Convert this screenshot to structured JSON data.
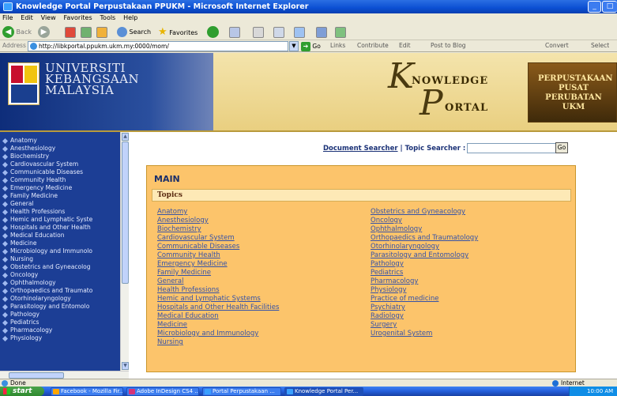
{
  "window": {
    "title": "Knowledge Portal Perpustakaan PPUKM - Microsoft Internet Explorer"
  },
  "menu": [
    "File",
    "Edit",
    "View",
    "Favorites",
    "Tools",
    "Help"
  ],
  "toolbar": {
    "back": "Back",
    "search": "Search",
    "favorites": "Favorites"
  },
  "addressbar": {
    "label": "Address",
    "url": "http://libkportal.ppukm.ukm.my:0000/mom/",
    "go": "Go",
    "links": "Links",
    "extra": [
      "Contribute",
      "Edit",
      "Post to Blog",
      "Convert",
      "Select"
    ]
  },
  "banner": {
    "university": [
      "UNIVERSITI",
      "KEBANGSAAN",
      "MALAYSIA"
    ],
    "kp_line1": "NOWLEDGE",
    "kp_line2": "ORTAL",
    "lib": "PERPUSTAKAAN PUSAT PERUBATAN UKM"
  },
  "sidebar": {
    "items": [
      "Anatomy",
      "Anesthesiology",
      "Biochemistry",
      "Cardiovascular System",
      "Communicable Diseases",
      "Community Health",
      "Emergency Medicine",
      "Family Medicine",
      "General",
      "Health Professions",
      "Hemic and Lymphatic Syste",
      "Hospitals and Other Health",
      "Medical Education",
      "Medicine",
      "Microbiology and Immunolo",
      "Nursing",
      "Obstetrics and Gyneacolog",
      "Oncology",
      "Ophthalmology",
      "Orthopaedics and Traumato",
      "Otorhinolaryngology",
      "Parasitology and Entomolo",
      "Pathology",
      "Pediatrics",
      "Pharmacology",
      "Physiology"
    ]
  },
  "search": {
    "document_searcher": "Document Searcher",
    "separator": "|",
    "topic_searcher": "Topic Searcher :",
    "input_value": "",
    "go": "Go"
  },
  "main": {
    "title": "MAIN",
    "topics_header": "Topics",
    "col1": [
      "Anatomy",
      "Anesthesiology",
      "Biochemistry",
      "Cardiovascular System",
      "Communicable Diseases",
      "Community Health",
      "Emergency Medicine",
      "Family Medicine",
      "General",
      "Health Professions",
      "Hemic and Lymphatic Systems",
      "Hospitals and Other Health Facilities",
      "Medical Education",
      "Medicine",
      "Microbiology and Immunology",
      "Nursing"
    ],
    "col2": [
      "Obstetrics and Gyneacology",
      "Oncology",
      "Ophthalmology",
      "Orthopaedics and Traumatology",
      "Otorhinolaryngology",
      "Parasitology and Entomology",
      "Pathology",
      "Pediatrics",
      "Pharmacology",
      "Physiology",
      "Practice of medicine",
      "Psychiatry",
      "Radiology",
      "Surgery",
      "Urogenital System"
    ]
  },
  "status": {
    "text": "Done",
    "zone": "Internet"
  },
  "taskbar": {
    "start": "start",
    "items": [
      "Facebook - Mozilla Fir...",
      "Adobe InDesign CS4 ...",
      "Portal Perpustakaan ...",
      "Knowledge Portal Per..."
    ],
    "clock": "10:00 AM"
  }
}
